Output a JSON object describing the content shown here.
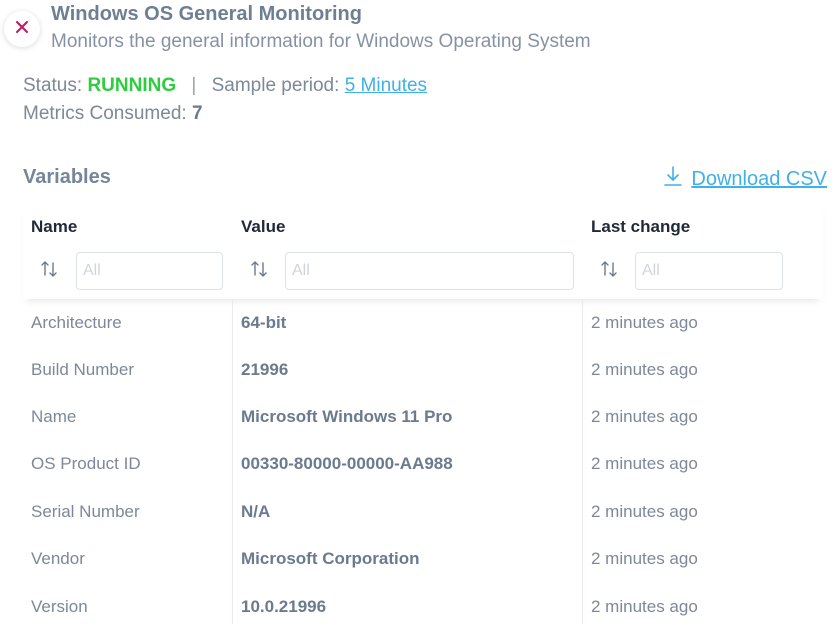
{
  "header": {
    "title": "Windows OS General Monitoring",
    "subtitle": "Monitors the general information for Windows Operating System"
  },
  "status": {
    "status_label": "Status:",
    "status_value": "RUNNING",
    "separator": "|",
    "sample_label": "Sample period:",
    "sample_value": "5 Minutes",
    "metrics_label": "Metrics Consumed:",
    "metrics_value": "7"
  },
  "variables": {
    "title": "Variables",
    "download_label": "Download CSV",
    "columns": [
      {
        "label": "Name",
        "placeholder": "All"
      },
      {
        "label": "Value",
        "placeholder": "All"
      },
      {
        "label": "Last change",
        "placeholder": "All"
      }
    ],
    "rows": [
      {
        "name": "Architecture",
        "value": "64-bit",
        "last_change": "2 minutes ago"
      },
      {
        "name": "Build Number",
        "value": "21996",
        "last_change": "2 minutes ago"
      },
      {
        "name": "Name",
        "value": "Microsoft Windows 11 Pro",
        "last_change": "2 minutes ago"
      },
      {
        "name": "OS Product ID",
        "value": "00330-80000-00000-AA988",
        "last_change": "2 minutes ago"
      },
      {
        "name": "Serial Number",
        "value": "N/A",
        "last_change": "2 minutes ago"
      },
      {
        "name": "Vendor",
        "value": "Microsoft Corporation",
        "last_change": "2 minutes ago"
      },
      {
        "name": "Version",
        "value": "10.0.21996",
        "last_change": "2 minutes ago"
      }
    ]
  },
  "colors": {
    "running": "#2ecc40",
    "link": "#3fb0e8",
    "close_icon": "#c2185b"
  },
  "icons": {
    "close": "close-icon",
    "download": "download-icon",
    "sort": "sort-icon"
  }
}
